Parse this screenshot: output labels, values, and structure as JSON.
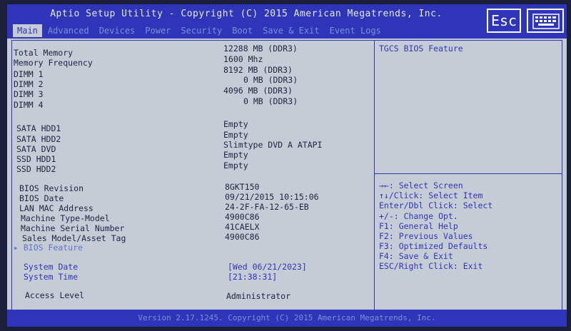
{
  "header": {
    "title": "Aptio Setup Utility - Copyright (C) 2015 American Megatrends, Inc.",
    "tabs": [
      "Main",
      "Advanced",
      "Devices",
      "Power",
      "Security",
      "Boot",
      "Save & Exit",
      "Event Logs"
    ],
    "esc_label": "Esc",
    "keyboard_icon": "keyboard-icon"
  },
  "main": {
    "memory": [
      {
        "label": "Total Memory",
        "value": "12288 MB (DDR3)"
      },
      {
        "label": "Memory Frequency",
        "value": "1600 Mhz"
      },
      {
        "label": "DIMM 1",
        "value": "8192 MB (DDR3)"
      },
      {
        "label": "DIMM 2",
        "value": "0 MB (DDR3)"
      },
      {
        "label": "DIMM 3",
        "value": "4096 MB (DDR3)"
      },
      {
        "label": "DIMM 4",
        "value": "0 MB (DDR3)"
      }
    ],
    "storage": [
      {
        "label": "SATA HDD1",
        "value": "Empty"
      },
      {
        "label": "SATA HDD2",
        "value": "Empty"
      },
      {
        "label": "SATA DVD",
        "value": "Slimtype DVD A ATAPI"
      },
      {
        "label": "SSD  HDD1",
        "value": "Empty"
      },
      {
        "label": "SSD  HDD2",
        "value": "Empty"
      }
    ],
    "system": [
      {
        "label": "BIOS Revision",
        "value": "8GKT150"
      },
      {
        "label": "BIOS Date",
        "value": "09/21/2015 10:15:06"
      },
      {
        "label": "LAN MAC Address",
        "value": "24-2F-FA-12-65-EB"
      },
      {
        "label": "Machine Type-Model",
        "value": "4900C86"
      },
      {
        "label": "Machine Serial Number",
        "value": "41CAELX"
      },
      {
        "label": "Sales Model/Asset Tag",
        "value": "4900C86"
      }
    ],
    "bios_feature": "BIOS Feature",
    "system_date_label": "System Date",
    "system_date_value": "[Wed 06/21/2023]",
    "system_time_label": "System Time",
    "system_time_value": "[21:38:31]",
    "access_level_label": "Access Level",
    "access_level_value": "Administrator"
  },
  "help": {
    "title": "TGCS BIOS Feature",
    "keys": [
      "→←: Select Screen",
      "↑↓/Click: Select Item",
      "Enter/Dbl Click: Select",
      "+/-: Change Opt.",
      "F1: General Help",
      "F2: Previous Values",
      "F3: Optimized Defaults",
      "F4: Save & Exit",
      "ESC/Right Click: Exit"
    ]
  },
  "footer": {
    "text": "Version 2.17.1245. Copyright (C) 2015 American Megatrends, Inc."
  },
  "colors": {
    "frame_blue": "#2f35b8",
    "panel_grey": "#c6ccd6",
    "text_dark": "#1f2340"
  }
}
